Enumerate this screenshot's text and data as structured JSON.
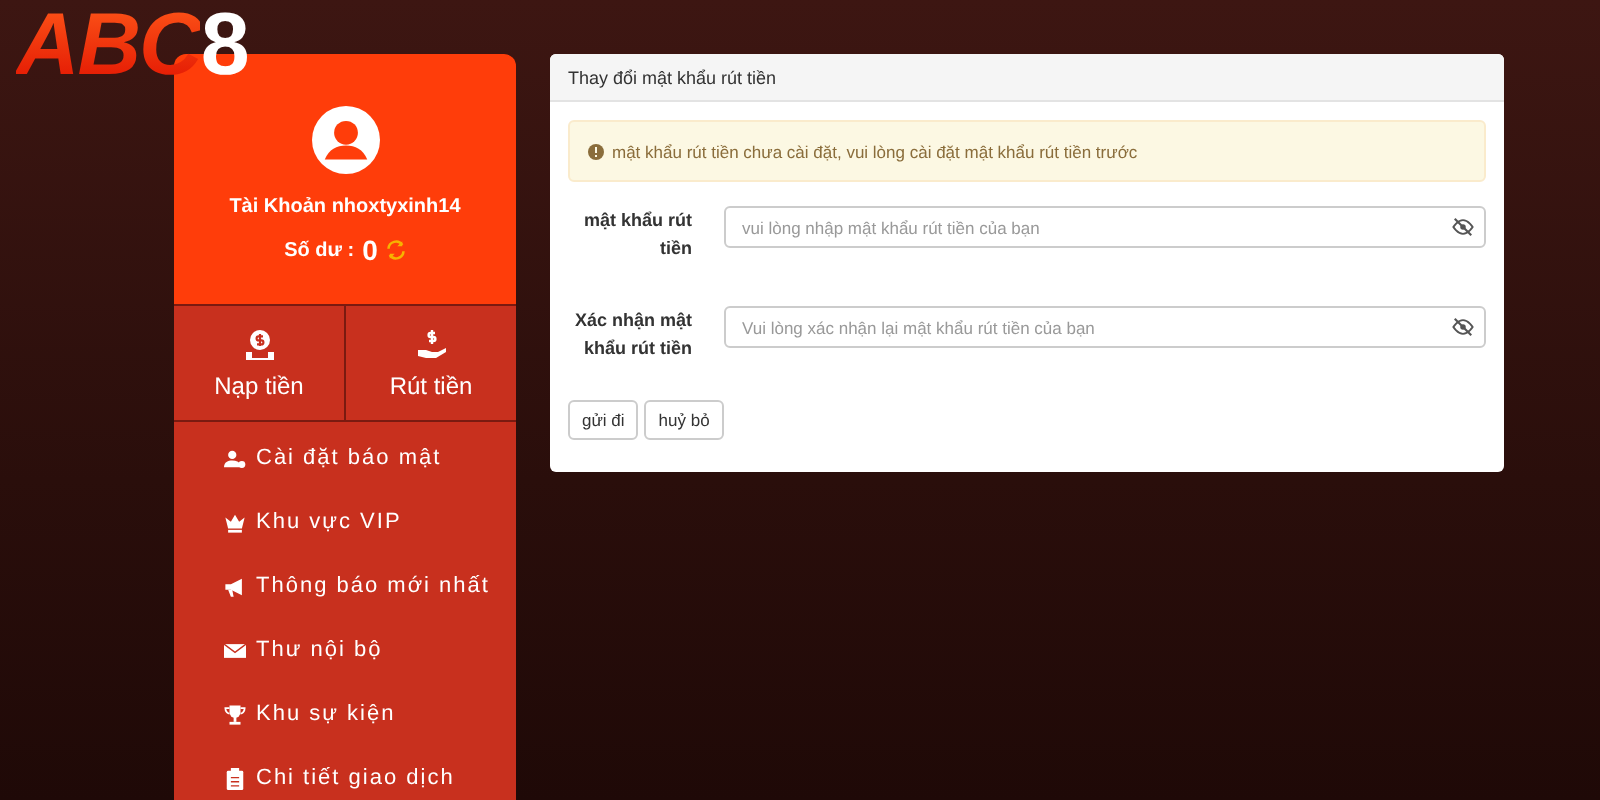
{
  "logo": {
    "letters": "ABC",
    "digit": "8"
  },
  "account": {
    "name": "Tài Khoản nhoxtyxinh14",
    "balance_label": "Số dư :",
    "balance": "0"
  },
  "actions": [
    {
      "label": "Nạp tiền"
    },
    {
      "label": "Rút tiền"
    }
  ],
  "menu": [
    {
      "label": "Cài đặt báo mật"
    },
    {
      "label": "Khu vực VIP"
    },
    {
      "label": "Thông báo mới nhất"
    },
    {
      "label": "Thư nội bộ"
    },
    {
      "label": "Khu sự kiện"
    },
    {
      "label": "Chi tiết giao dịch"
    }
  ],
  "panel": {
    "title": "Thay đổi mật khẩu rút tiền",
    "alert": "mật khẩu rút tiền chưa cài đặt, vui lòng cài đặt mật khẩu rút tiền trước",
    "fields": [
      {
        "label": "mật khẩu rút tiền",
        "placeholder": "vui lòng nhập mật khẩu rút tiền của bạn"
      },
      {
        "label": "Xác nhận mật khẩu rút tiền",
        "placeholder": "Vui lòng xác nhận lại mật khẩu rút tiền của bạn"
      }
    ],
    "buttons": [
      "gửi đi",
      "huỷ bỏ"
    ]
  }
}
